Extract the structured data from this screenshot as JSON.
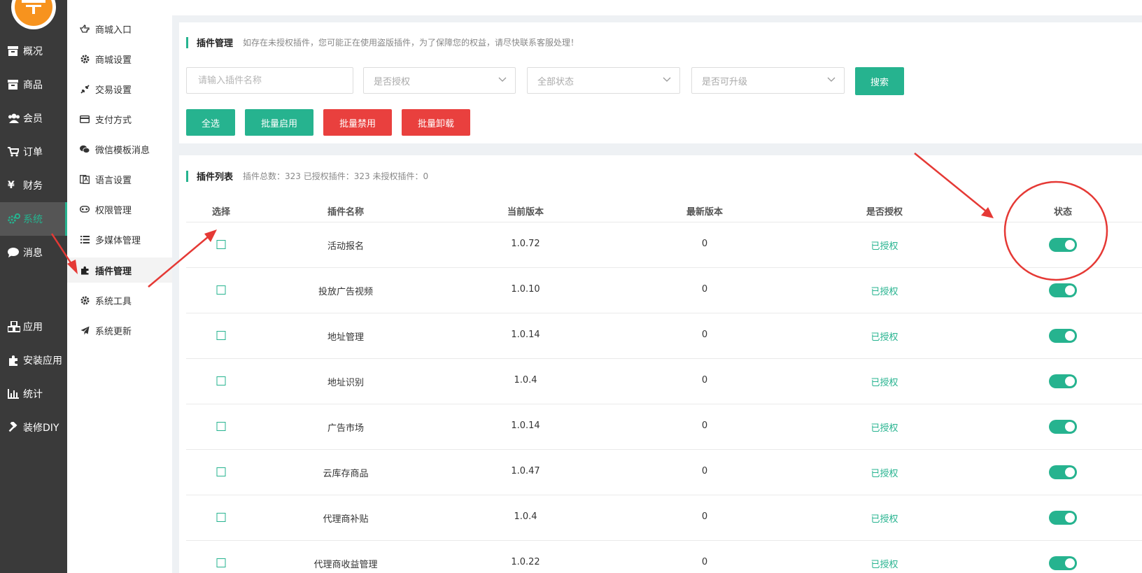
{
  "sidebar": {
    "items": [
      {
        "label": "概况",
        "icon": "archive-icon"
      },
      {
        "label": "商品",
        "icon": "archive-icon"
      },
      {
        "label": "会员",
        "icon": "users-icon"
      },
      {
        "label": "订单",
        "icon": "cart-icon"
      },
      {
        "label": "财务",
        "icon": "yen-icon"
      },
      {
        "label": "系统",
        "icon": "cogs-icon",
        "active": true
      },
      {
        "label": "消息",
        "icon": "chat-icon"
      },
      {
        "label": "应用",
        "icon": "cubes-icon"
      },
      {
        "label": "安装应用",
        "icon": "puzzle-icon"
      },
      {
        "label": "统计",
        "icon": "bar-chart-icon"
      },
      {
        "label": "装修DIY",
        "icon": "gavel-icon"
      }
    ]
  },
  "submenu": {
    "items": [
      {
        "label": "商城入口",
        "icon": "hand-point-icon"
      },
      {
        "label": "商城设置",
        "icon": "gear-icon"
      },
      {
        "label": "交易设置",
        "icon": "compress-icon"
      },
      {
        "label": "支付方式",
        "icon": "credit-card-icon"
      },
      {
        "label": "微信模板消息",
        "icon": "wechat-icon"
      },
      {
        "label": "语言设置",
        "icon": "language-icon"
      },
      {
        "label": "权限管理",
        "icon": "gamepad-icon"
      },
      {
        "label": "多媒体管理",
        "icon": "list-icon"
      },
      {
        "label": "插件管理",
        "icon": "puzzle-icon",
        "active": true
      },
      {
        "label": "系统工具",
        "icon": "gear-icon"
      },
      {
        "label": "系统更新",
        "icon": "paper-plane-icon"
      }
    ]
  },
  "filter": {
    "title": "插件管理",
    "notice": "如存在未授权插件，您可能正在使用盗版插件，为了保障您的权益，请尽快联系客服处理！",
    "search_placeholder": "请输入插件名称",
    "auth_select": "是否授权",
    "status_select": "全部状态",
    "upgrade_select": "是否可升级",
    "search_button": "搜索",
    "select_all": "全选",
    "batch_enable": "批量启用",
    "batch_disable": "批量禁用",
    "batch_uninstall": "批量卸载"
  },
  "list": {
    "title": "插件列表",
    "summary": "插件总数：323 已授权插件：323 未授权插件：0",
    "columns": [
      "选择",
      "插件名称",
      "当前版本",
      "最新版本",
      "是否授权",
      "状态"
    ],
    "rows": [
      {
        "name": "活动报名",
        "current": "1.0.72",
        "latest": "0",
        "auth": "已授权",
        "enabled": true
      },
      {
        "name": "投放广告视频",
        "current": "1.0.10",
        "latest": "0",
        "auth": "已授权",
        "enabled": true
      },
      {
        "name": "地址管理",
        "current": "1.0.14",
        "latest": "0",
        "auth": "已授权",
        "enabled": true
      },
      {
        "name": "地址识别",
        "current": "1.0.4",
        "latest": "0",
        "auth": "已授权",
        "enabled": true
      },
      {
        "name": "广告市场",
        "current": "1.0.14",
        "latest": "0",
        "auth": "已授权",
        "enabled": true
      },
      {
        "name": "云库存商品",
        "current": "1.0.47",
        "latest": "0",
        "auth": "已授权",
        "enabled": true
      },
      {
        "name": "代理商补贴",
        "current": "1.0.4",
        "latest": "0",
        "auth": "已授权",
        "enabled": true
      },
      {
        "name": "代理商收益管理",
        "current": "1.0.22",
        "latest": "0",
        "auth": "已授权",
        "enabled": true
      }
    ]
  },
  "colors": {
    "accent": "#26b38f",
    "danger": "#e9403e",
    "sidebar_bg": "#3a3a3a",
    "logo": "#f7931e",
    "annotation": "#e53935"
  }
}
